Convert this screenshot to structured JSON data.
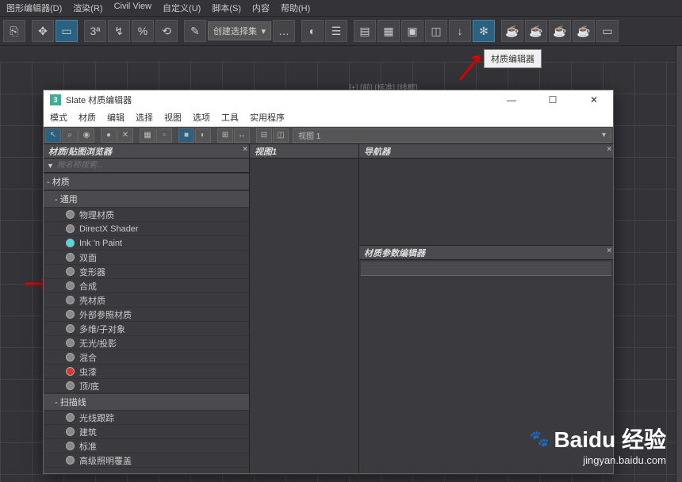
{
  "main_menu": {
    "items": [
      "图形编辑器(D)",
      "渲染(R)",
      "Civil View",
      "自定义(U)",
      "脚本(S)",
      "内容",
      "帮助(H)"
    ]
  },
  "main_toolbar": {
    "selection_set": "创建选择集"
  },
  "viewport": {
    "label": "[+] [前] [标准] [线框]"
  },
  "tooltip": "材质编辑器",
  "dialog": {
    "title": "Slate 材质编辑器",
    "icon_text": "3",
    "menu": [
      "模式",
      "材质",
      "编辑",
      "选择",
      "视图",
      "选项",
      "工具",
      "实用程序"
    ],
    "view_dropdown": "视图 1",
    "browser": {
      "title": "材质/贴图浏览器",
      "search_placeholder": "按名称搜索...",
      "group_materials": "- 材质",
      "group_general": "- 通用",
      "group_scanline": "- 扫描线",
      "items_general": [
        {
          "label": "物理材质",
          "color": "grey"
        },
        {
          "label": "DirectX Shader",
          "color": "grey"
        },
        {
          "label": "Ink 'n Paint",
          "color": "cyan"
        },
        {
          "label": "双面",
          "color": "grey"
        },
        {
          "label": "变形器",
          "color": "grey"
        },
        {
          "label": "合成",
          "color": "grey"
        },
        {
          "label": "壳材质",
          "color": "grey"
        },
        {
          "label": "外部参照材质",
          "color": "grey"
        },
        {
          "label": "多维/子对象",
          "color": "grey"
        },
        {
          "label": "无光/投影",
          "color": "grey"
        },
        {
          "label": "混合",
          "color": "grey"
        },
        {
          "label": "虫漆",
          "color": "red"
        },
        {
          "label": "顶/底",
          "color": "grey"
        }
      ],
      "items_scanline": [
        {
          "label": "光线跟踪",
          "color": "grey"
        },
        {
          "label": "建筑",
          "color": "grey"
        },
        {
          "label": "标准",
          "color": "grey"
        },
        {
          "label": "高级照明覆盖",
          "color": "grey"
        }
      ]
    },
    "center": {
      "view_title": "视图1"
    },
    "right": {
      "nav_title": "导航器",
      "param_title": "材质参数编辑器"
    }
  },
  "watermark": {
    "logo": "Baidu 经验",
    "url": "jingyan.baidu.com"
  }
}
